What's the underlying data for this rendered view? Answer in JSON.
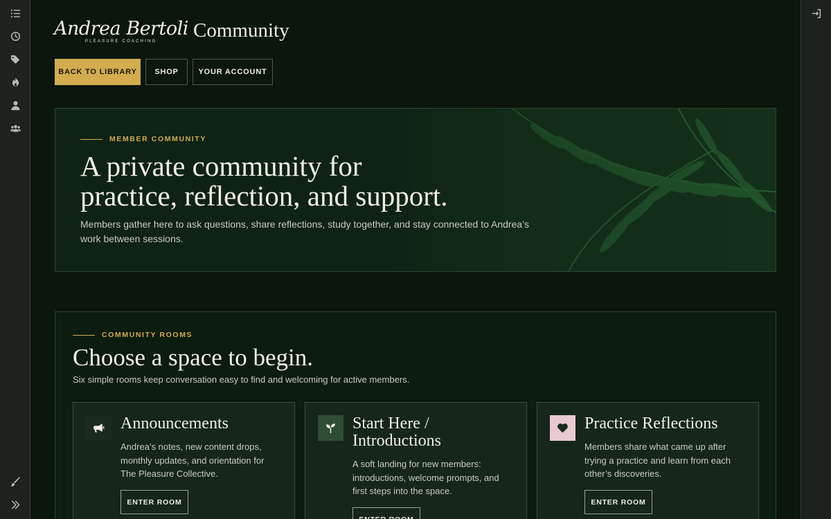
{
  "brand": {
    "name": "Andrea Bertoli",
    "tagline": "PLEASURE COACHING",
    "page": "Community"
  },
  "nav": {
    "back": "BACK TO LIBRARY",
    "shop": "SHOP",
    "account": "YOUR ACCOUNT"
  },
  "sidebar": {
    "icons": [
      "list-icon",
      "clock-icon",
      "tags-icon",
      "fire-icon",
      "user-icon",
      "users-icon",
      "brush-icon",
      "expand-icon"
    ]
  },
  "hero": {
    "eyebrow": "MEMBER COMMUNITY",
    "title_line1": "A private community for",
    "title_line2": "practice, reflection, and support.",
    "description": "Members gather here to ask questions, share reflections, study together, and stay connected to Andrea’s work between sessions."
  },
  "rooms": {
    "eyebrow": "COMMUNITY ROOMS",
    "title": "Choose a space to begin.",
    "description": "Six simple rooms keep conversation easy to find and welcoming for active members.",
    "cards": [
      {
        "title": "Announcements",
        "description": "Andrea’s notes, new content drops, monthly updates, and orientation for The Pleasure Collective.",
        "button": "ENTER ROOM",
        "icon": "megaphone-icon"
      },
      {
        "title_line1": "Start Here /",
        "title_line2": "Introductions",
        "description": "A soft landing for new members: introductions, welcome prompts, and first steps into the space.",
        "button": "ENTER ROOM",
        "icon": "seedling-icon"
      },
      {
        "title": "Practice Reflections",
        "description": "Members share what came up after trying a practice and learn from each other’s discoveries.",
        "button": "ENTER ROOM",
        "icon": "heart-icon"
      }
    ]
  },
  "colors": {
    "accent": "#d2ac4f",
    "background": "#0b170d",
    "heart_bg": "#e7c9cf",
    "seedling_bg": "#2f4d35"
  }
}
